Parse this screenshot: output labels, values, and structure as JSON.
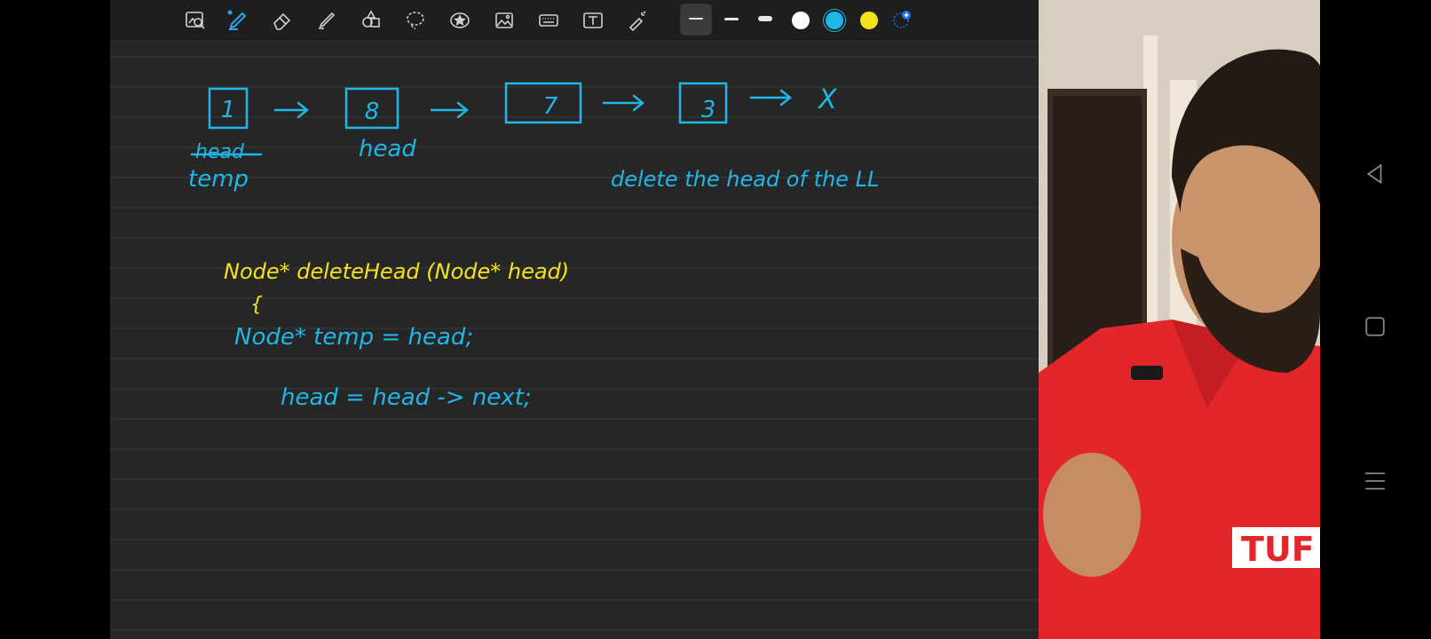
{
  "toolbar": {
    "tools": [
      "scan-icon",
      "pen-icon",
      "eraser-icon",
      "highlighter-icon",
      "shapes-icon",
      "lasso-icon",
      "sticker-icon",
      "image-icon",
      "keyboard-icon",
      "text-icon",
      "laser-pointer-icon"
    ],
    "stroke_sizes": [
      "thin",
      "medium",
      "thick"
    ],
    "colors": [
      "#ffffff",
      "#1fb6e8",
      "#f5e31a"
    ],
    "active_color": "#1fb6e8"
  },
  "notes": {
    "nodes": [
      "1",
      "8",
      "7",
      "3"
    ],
    "null_marker": "X",
    "label_head_struck": "head",
    "label_temp": "temp",
    "label_head": "head",
    "caption": "delete the head of the LL",
    "code": [
      "Node* deleteHead (Node* head)",
      "{",
      "Node* temp = head;",
      "head = head -> next;"
    ]
  },
  "camera": {
    "shirt_logo": "TUF"
  }
}
